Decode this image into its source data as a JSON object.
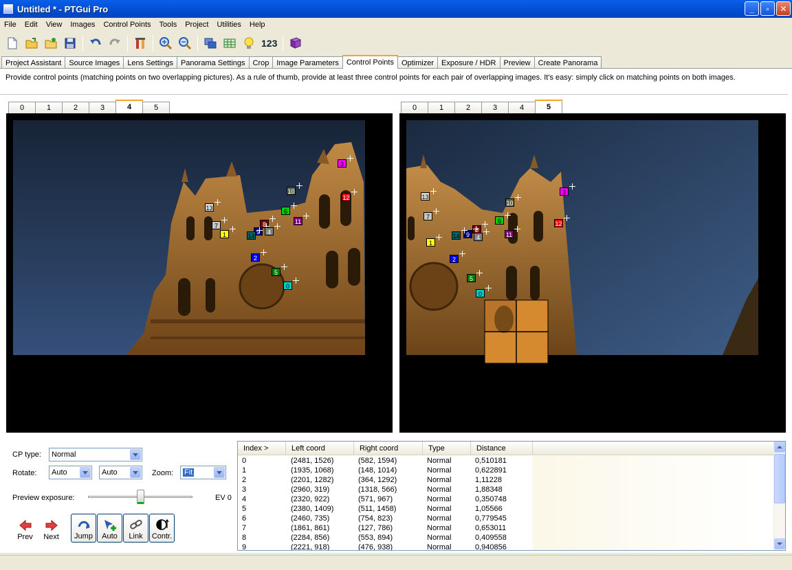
{
  "window": {
    "title": "Untitled * - PTGui Pro",
    "minimize": "_",
    "maximize": "▫",
    "close": "✕"
  },
  "menu": [
    "File",
    "Edit",
    "View",
    "Images",
    "Control Points",
    "Tools",
    "Project",
    "Utilities",
    "Help"
  ],
  "toolbar": {
    "numbers_label": "123",
    "icons": [
      "new-file-icon",
      "open-folder-icon",
      "open-recent-icon",
      "save-icon",
      "undo-icon",
      "redo-icon",
      "tools-icon",
      "zoom-in-icon",
      "zoom-out-icon",
      "windows-icon",
      "table-icon",
      "lightbulb-icon",
      "book-icon"
    ]
  },
  "tabs": [
    "Project Assistant",
    "Source Images",
    "Lens Settings",
    "Panorama Settings",
    "Crop",
    "Image Parameters",
    "Control Points",
    "Optimizer",
    "Exposure / HDR",
    "Preview",
    "Create Panorama"
  ],
  "active_tab": "Control Points",
  "instruction": "Provide control points (matching points on two overlapping pictures). As a rule of thumb, provide at least three control points for each pair of overlapping images. It's easy: simply click on matching points on both images.",
  "left_image_tabs": [
    "0",
    "1",
    "2",
    "3",
    "4",
    "5"
  ],
  "left_active": "4",
  "right_image_tabs": [
    "0",
    "1",
    "2",
    "3",
    "4",
    "5"
  ],
  "right_active": "5",
  "left_points": [
    {
      "n": "13",
      "color": "#dcdcdc",
      "text": "#000"
    },
    {
      "n": "7",
      "color": "#c8c8c8",
      "text": "#000"
    },
    {
      "n": "1",
      "color": "#ffff00",
      "text": "#000"
    },
    {
      "n": "10",
      "color": "#5a6a52",
      "text": "#fff"
    },
    {
      "n": "3",
      "color": "#ff00ff",
      "text": "#000"
    },
    {
      "n": "12",
      "color": "#ff0000",
      "text": "#fff"
    },
    {
      "n": "6",
      "color": "#00cc00",
      "text": "#000"
    },
    {
      "n": "8",
      "color": "#7a0000",
      "text": "#fff"
    },
    {
      "n": "9",
      "color": "#000080",
      "text": "#fff"
    },
    {
      "n": "4",
      "color": "#808080",
      "text": "#fff"
    },
    {
      "n": "14",
      "color": "#006666",
      "text": "#000"
    },
    {
      "n": "11",
      "color": "#800080",
      "text": "#fff"
    },
    {
      "n": "2",
      "color": "#0000ee",
      "text": "#fff"
    },
    {
      "n": "5",
      "color": "#008000",
      "text": "#fff"
    },
    {
      "n": "0",
      "color": "#00cccc",
      "text": "#000"
    }
  ],
  "right_points": [
    {
      "n": "13",
      "color": "#dcdcdc",
      "text": "#000"
    },
    {
      "n": "7",
      "color": "#c8c8c8",
      "text": "#000"
    },
    {
      "n": "1",
      "color": "#ffff00",
      "text": "#000"
    },
    {
      "n": "10",
      "color": "#5a6a52",
      "text": "#fff"
    },
    {
      "n": "3",
      "color": "#ff00ff",
      "text": "#000"
    },
    {
      "n": "12",
      "color": "#ff0000",
      "text": "#fff"
    },
    {
      "n": "6",
      "color": "#00cc00",
      "text": "#000"
    },
    {
      "n": "8",
      "color": "#7a0000",
      "text": "#fff"
    },
    {
      "n": "9",
      "color": "#000080",
      "text": "#fff"
    },
    {
      "n": "4",
      "color": "#808080",
      "text": "#fff"
    },
    {
      "n": "14",
      "color": "#006666",
      "text": "#000"
    },
    {
      "n": "11",
      "color": "#800080",
      "text": "#fff"
    },
    {
      "n": "2",
      "color": "#0000ee",
      "text": "#fff"
    },
    {
      "n": "5",
      "color": "#008000",
      "text": "#fff"
    },
    {
      "n": "0",
      "color": "#00cccc",
      "text": "#000"
    }
  ],
  "controls": {
    "cp_type_label": "CP type:",
    "cp_type_value": "Normal",
    "rotate_label": "Rotate:",
    "rotate_left": "Auto",
    "rotate_right": "Auto",
    "zoom_label": "Zoom:",
    "zoom_value": "Fit",
    "preview_exposure_label": "Preview exposure:",
    "ev_value": "EV 0",
    "exposure_level": 0.5
  },
  "buttons": {
    "prev": "Prev",
    "next": "Next",
    "jump": "Jump",
    "auto": "Auto",
    "link": "Link",
    "contr": "Contr."
  },
  "table": {
    "headers": [
      "Index >",
      "Left coord",
      "Right coord",
      "Type",
      "Distance"
    ],
    "rows": [
      [
        "0",
        "(2481, 1526)",
        "(582, 1594)",
        "Normal",
        "0,510181"
      ],
      [
        "1",
        "(1935, 1068)",
        "(148, 1014)",
        "Normal",
        "0,622891"
      ],
      [
        "2",
        "(2201, 1282)",
        "(364, 1292)",
        "Normal",
        "1,11228"
      ],
      [
        "3",
        "(2960, 319)",
        "(1318, 566)",
        "Normal",
        "1,88348"
      ],
      [
        "4",
        "(2320, 922)",
        "(571, 967)",
        "Normal",
        "0,350748"
      ],
      [
        "5",
        "(2380, 1409)",
        "(511, 1458)",
        "Normal",
        "1,05566"
      ],
      [
        "6",
        "(2460, 735)",
        "(754, 823)",
        "Normal",
        "0,779545"
      ],
      [
        "7",
        "(1861, 861)",
        "(127, 786)",
        "Normal",
        "0,653011"
      ],
      [
        "8",
        "(2284, 856)",
        "(553, 894)",
        "Normal",
        "0,409558"
      ],
      [
        "9",
        "(2221, 918)",
        "(476, 938)",
        "Normal",
        "0,940856"
      ]
    ]
  }
}
